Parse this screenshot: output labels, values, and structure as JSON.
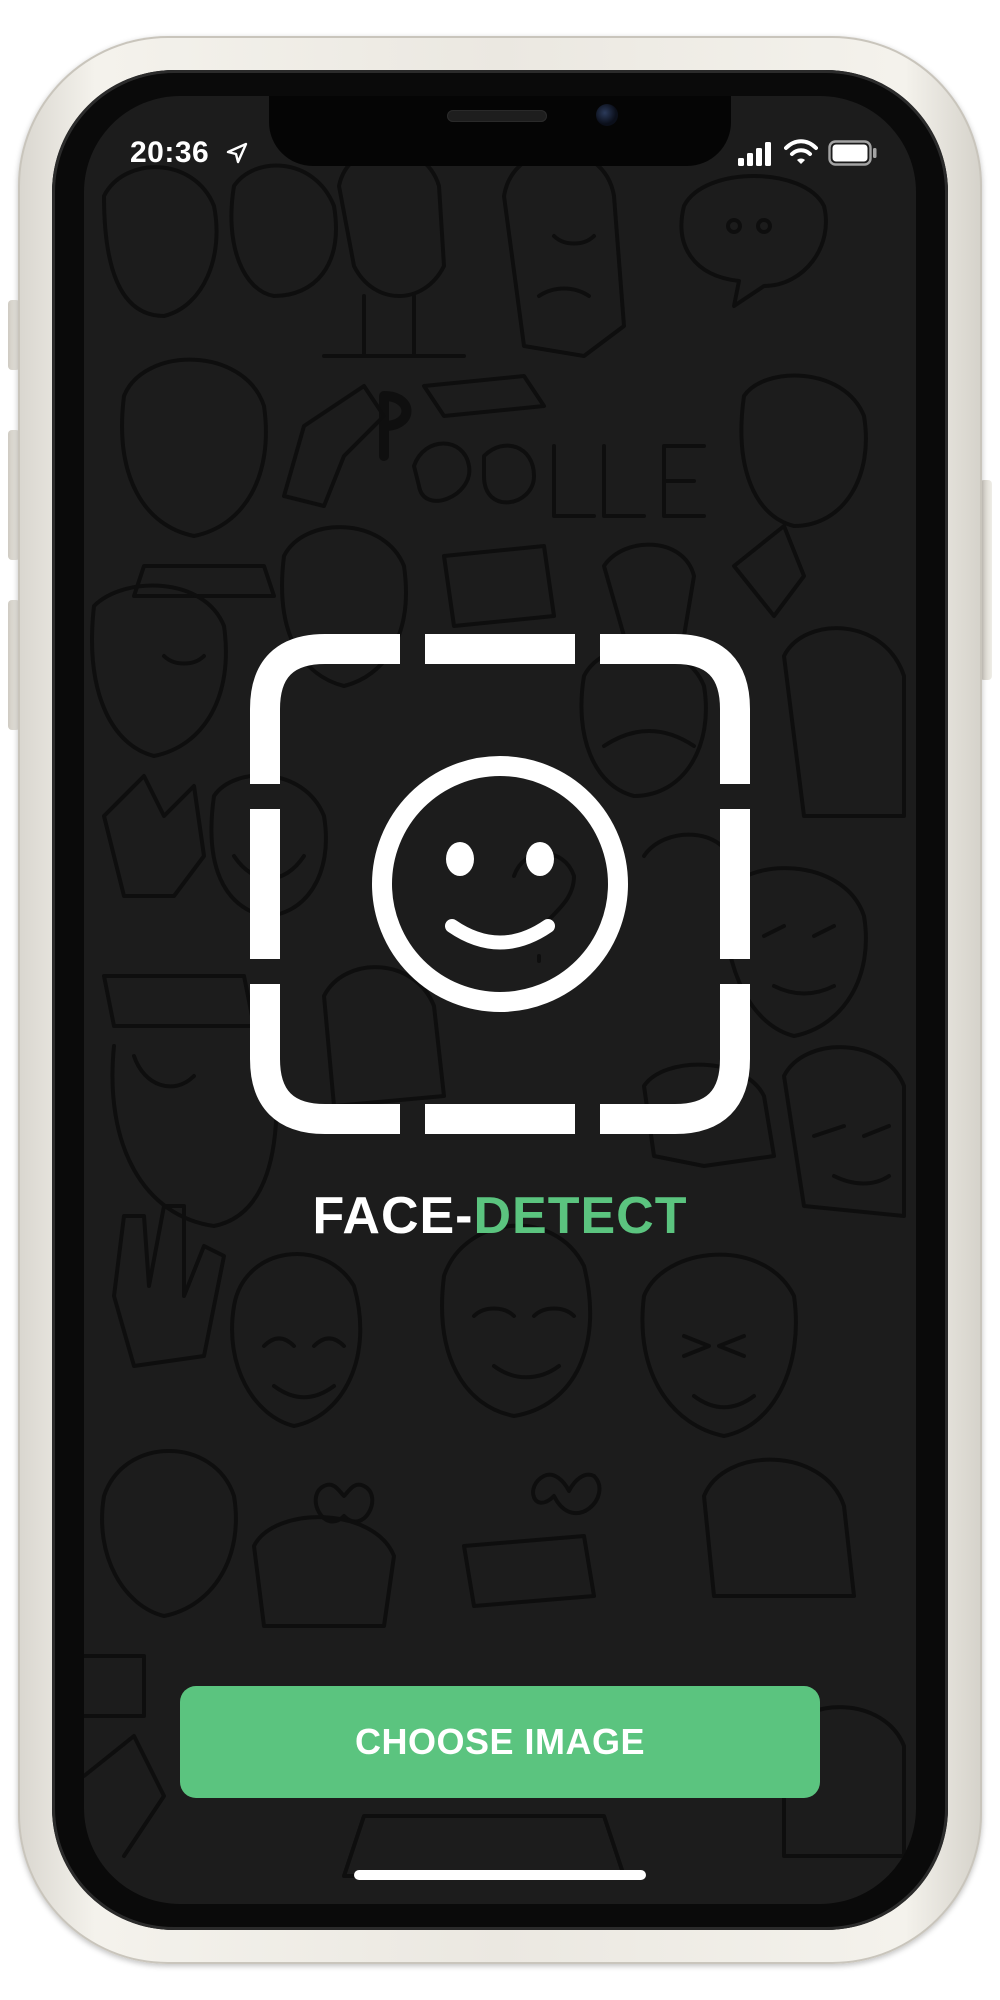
{
  "status_bar": {
    "time": "20:36",
    "location_icon": "location-arrow-icon",
    "signal_icon": "cellular-signal-icon",
    "wifi_icon": "wifi-icon",
    "battery_icon": "battery-icon"
  },
  "app": {
    "logo_icon": "face-detect-icon",
    "title_part1": "FACE-",
    "title_part2": "DETECT"
  },
  "actions": {
    "choose_image_label": "CHOOSE IMAGE"
  },
  "colors": {
    "accent": "#5bc47f",
    "background": "#1c1c1c",
    "text": "#ffffff"
  }
}
